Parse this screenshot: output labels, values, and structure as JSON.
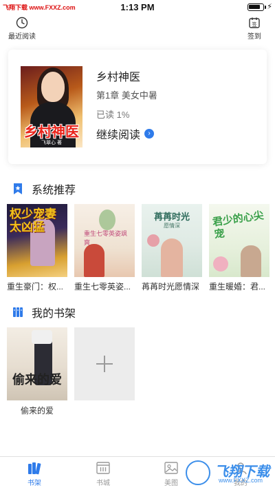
{
  "status_bar": {
    "left_text": "飞翔下载 www.FXXZ.com",
    "time": "1:13 PM",
    "battery_level": 0.85
  },
  "topbar": {
    "recent_label": "最近阅读",
    "checkin_label": "签到",
    "checkin_icon_text": "签"
  },
  "current_book": {
    "title": "乡村神医",
    "chapter": "第1章  美女中暑",
    "progress": "已读 1%",
    "continue_label": "继续阅读",
    "cover_title": "乡村神医",
    "cover_author": "飞翠心 著"
  },
  "recommend": {
    "heading": "系统推荐",
    "books": [
      {
        "title": "重生豪门：权...",
        "cover_text": "权少宠妻太凶猛"
      },
      {
        "title": "重生七零英姿...",
        "cover_text": "重生七零英姿飒爽"
      },
      {
        "title": "苒苒时光愿情深",
        "cover_text": "苒苒时光",
        "cover_sub": "愿情深"
      },
      {
        "title": "重生暖婚：君...",
        "cover_text": "君少的心尖宠"
      }
    ]
  },
  "shelf": {
    "heading": "我的书架",
    "books": [
      {
        "title": "偷来的爱",
        "cover_text": "偷来的爱"
      }
    ]
  },
  "tabbar": {
    "tabs": [
      {
        "label": "书架",
        "active": true
      },
      {
        "label": "书城",
        "active": false
      },
      {
        "label": "美图",
        "active": false
      },
      {
        "label": "我的",
        "active": false
      }
    ]
  },
  "watermark": {
    "brand": "飞翔下载",
    "url": "www.FXXZ.com"
  },
  "colors": {
    "accent": "#2f7bea",
    "watermark": "#d11111"
  }
}
